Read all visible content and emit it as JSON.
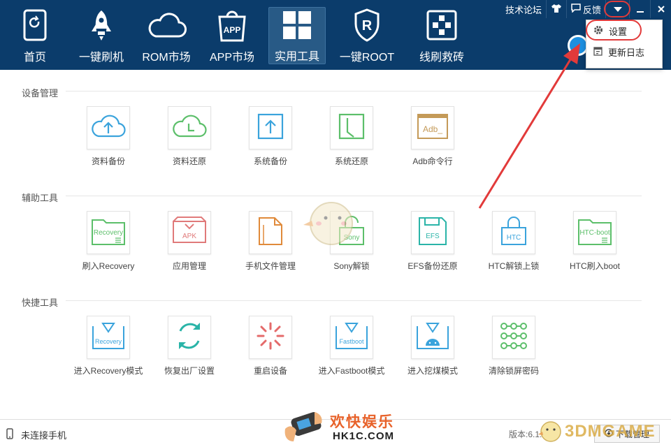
{
  "header": {
    "nav": [
      {
        "label": "首页",
        "icon": "phone-refresh-icon"
      },
      {
        "label": "一键刷机",
        "icon": "rocket-icon"
      },
      {
        "label": "ROM市场",
        "icon": "cloud-icon"
      },
      {
        "label": "APP市场",
        "icon": "shopping-bag-icon"
      },
      {
        "label": "实用工具",
        "icon": "grid-icon",
        "active": true
      },
      {
        "label": "一键ROOT",
        "icon": "shield-r-icon"
      },
      {
        "label": "线刷救砖",
        "icon": "circuit-icon"
      }
    ]
  },
  "topbar": {
    "forum": "技术论坛",
    "feedback": "反馈"
  },
  "dropdown": {
    "items": [
      {
        "label": "设置",
        "icon": "gear-icon"
      },
      {
        "label": "更新日志",
        "icon": "log-icon"
      }
    ]
  },
  "sections": [
    {
      "title": "设备管理",
      "tools": [
        {
          "name": "资料备份",
          "icon": "cloud-upload-icon"
        },
        {
          "name": "资料还原",
          "icon": "cloud-clock-icon"
        },
        {
          "name": "系统备份",
          "icon": "system-backup-icon"
        },
        {
          "name": "系统还原",
          "icon": "system-restore-icon"
        },
        {
          "name": "Adb命令行",
          "icon": "adb-terminal-icon",
          "tag": "Adb_"
        }
      ]
    },
    {
      "title": "辅助工具",
      "tools": [
        {
          "name": "刷入Recovery",
          "icon": "recovery-folder-icon",
          "tag": "Recovery"
        },
        {
          "name": "应用管理",
          "icon": "apk-tray-icon",
          "tag": "APK"
        },
        {
          "name": "手机文件管理",
          "icon": "file-manager-icon"
        },
        {
          "name": "Sony解锁",
          "icon": "sony-unlock-icon",
          "tag": "Sony"
        },
        {
          "name": "EFS备份还原",
          "icon": "efs-floppy-icon",
          "tag": "EFS"
        },
        {
          "name": "HTC解锁上锁",
          "icon": "htc-lock-icon",
          "tag": "HTC"
        },
        {
          "name": "HTC刷入boot",
          "icon": "htc-boot-folder-icon",
          "tag": "HTC-boot"
        }
      ]
    },
    {
      "title": "快捷工具",
      "tools": [
        {
          "name": "进入Recovery模式",
          "icon": "recovery-mode-icon",
          "tag": "Recovery"
        },
        {
          "name": "恢复出厂设置",
          "icon": "factory-reset-icon"
        },
        {
          "name": "重启设备",
          "icon": "reboot-icon"
        },
        {
          "name": "进入Fastboot模式",
          "icon": "fastboot-mode-icon",
          "tag": "Fastboot"
        },
        {
          "name": "进入挖煤模式",
          "icon": "android-mode-icon"
        },
        {
          "name": "清除锁屏密码",
          "icon": "pattern-lock-icon"
        }
      ]
    }
  ],
  "status": {
    "connection": "未连接手机",
    "version": "版本:6.1.3.0",
    "manager": "下载管理"
  },
  "watermarks": {
    "site_cn": "欢快娱乐",
    "site": "HK1C.COM",
    "brand": "3DMGAME"
  },
  "colors": {
    "header_bg": "#0b3c6b",
    "annotation_red": "#e23a3a",
    "blue": "#3aa3dc",
    "green": "#5cbf6a",
    "orange": "#e08a3a",
    "red": "#e05a5a",
    "teal": "#2ab4a8"
  }
}
